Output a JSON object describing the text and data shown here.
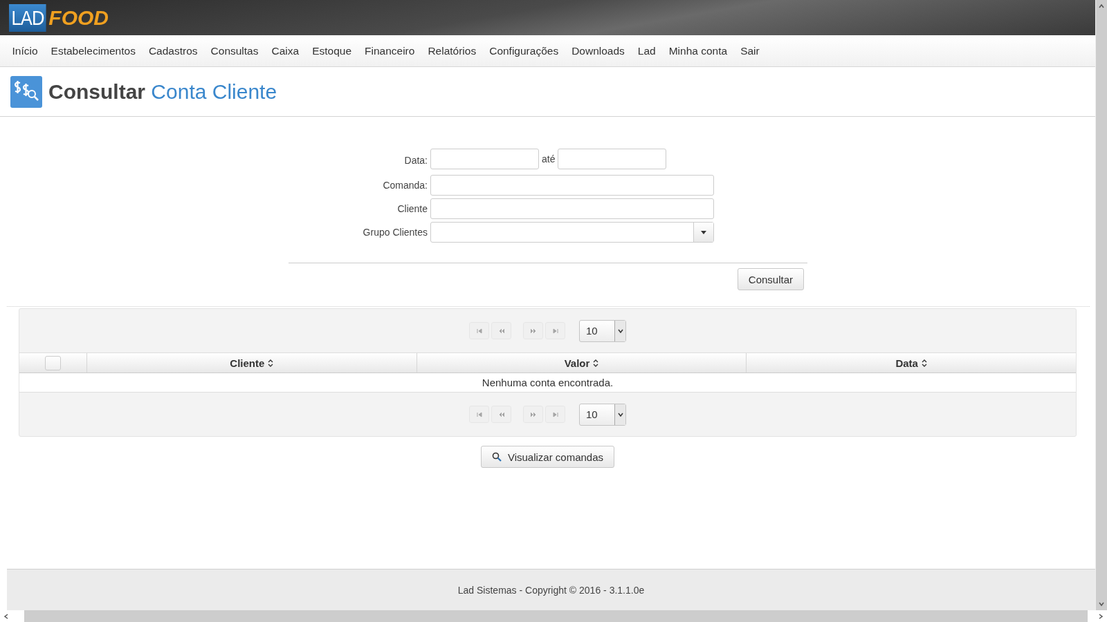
{
  "logo": {
    "part_1": "LAD",
    "part_2": "FOOD"
  },
  "nav": [
    "Início",
    "Estabelecimentos",
    "Cadastros",
    "Consultas",
    "Caixa",
    "Estoque",
    "Financeiro",
    "Relatórios",
    "Configurações",
    "Downloads",
    "Lad",
    "Minha conta",
    "Sair"
  ],
  "page_title": {
    "verb": "Consultar",
    "subject": "Conta Cliente"
  },
  "form": {
    "date_label": "Data:",
    "date_separator": "até",
    "fields": [
      {
        "label": "Comanda:",
        "kind": "text"
      },
      {
        "label": "Cliente",
        "kind": "text"
      },
      {
        "label": "Grupo Clientes",
        "kind": "select"
      }
    ],
    "submit": "Consultar"
  },
  "table": {
    "pager_top": {
      "disabled": true,
      "page_size": "10"
    },
    "select_all": {
      "checked": false
    },
    "columns": [
      "Cliente",
      "Valor",
      "Data"
    ],
    "empty_message": "Nenhuma conta encontrada.",
    "pager_bottom": {
      "disabled": true,
      "page_size": "10"
    }
  },
  "action_button": "Visualizar comandas",
  "footer": "Lad Sistemas - Copyright © 2016 - 3.1.1.0e"
}
